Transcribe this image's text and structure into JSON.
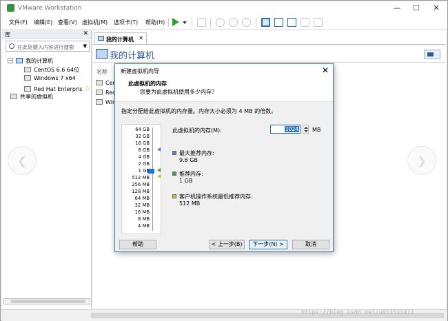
{
  "window": {
    "title": "VMware Workstation",
    "controls": [
      "—",
      "☐",
      "✕"
    ]
  },
  "menu": [
    "文件(F)",
    "编辑(E)",
    "查看(V)",
    "虚拟机(M)",
    "选项卡(T)",
    "帮助(H)"
  ],
  "library": {
    "title": "库",
    "close": "✕",
    "search_placeholder": "在此处键入内容进行搜索",
    "root_label": "我的计算机",
    "items": [
      "CentOS 6.6 64位",
      "Windows 7 x64",
      "Red Hat Enterpris"
    ],
    "shared_label": "共享的虚拟机",
    "expander": "−"
  },
  "main": {
    "tab_label": "我的计算机",
    "tab_close": "✕",
    "header_title": "我的计算机",
    "column_name": "名称",
    "rows": [
      "Cent",
      "Red",
      "Wind"
    ]
  },
  "nav": {
    "prev": "❮",
    "next": "❯"
  },
  "dialog": {
    "title": "新建虚拟机向导",
    "close": "✕",
    "heading": "此虚拟机的内存",
    "subheading": "您要为此虚拟机使用多少内存？",
    "instruction": "指定分配给此虚拟机的内存量。内存大小必须为 4 MB 的倍数。",
    "memory_label": "此虚拟机的内存(M):",
    "memory_value": "1024",
    "memory_unit": "MB",
    "scale_ticks": [
      "64 GB",
      "32 GB",
      "16 GB",
      "8 GB",
      "4 GB",
      "2 GB",
      "1 GB",
      "512 MB",
      "256 MB",
      "128 MB",
      "64 MB",
      "32 MB",
      "16 MB",
      "8 MB",
      "4 MB"
    ],
    "max_recommended_label": "最大推荐内存:",
    "max_recommended_value": "9.6 GB",
    "recommended_label": "推荐内存:",
    "recommended_value": "1 GB",
    "guest_min_label": "客户机操作系统最低推荐内存:",
    "guest_min_value": "512 MB",
    "buttons": {
      "help": "帮助",
      "back": "< 上一步(B)",
      "next": "下一步(N) >",
      "cancel": "取消"
    },
    "colors": {
      "max": "#5b7fd1",
      "recommended": "#3aa83a",
      "guest_min": "#d4c020"
    }
  },
  "watermark": "https://blog.csdn.net/u013511411"
}
